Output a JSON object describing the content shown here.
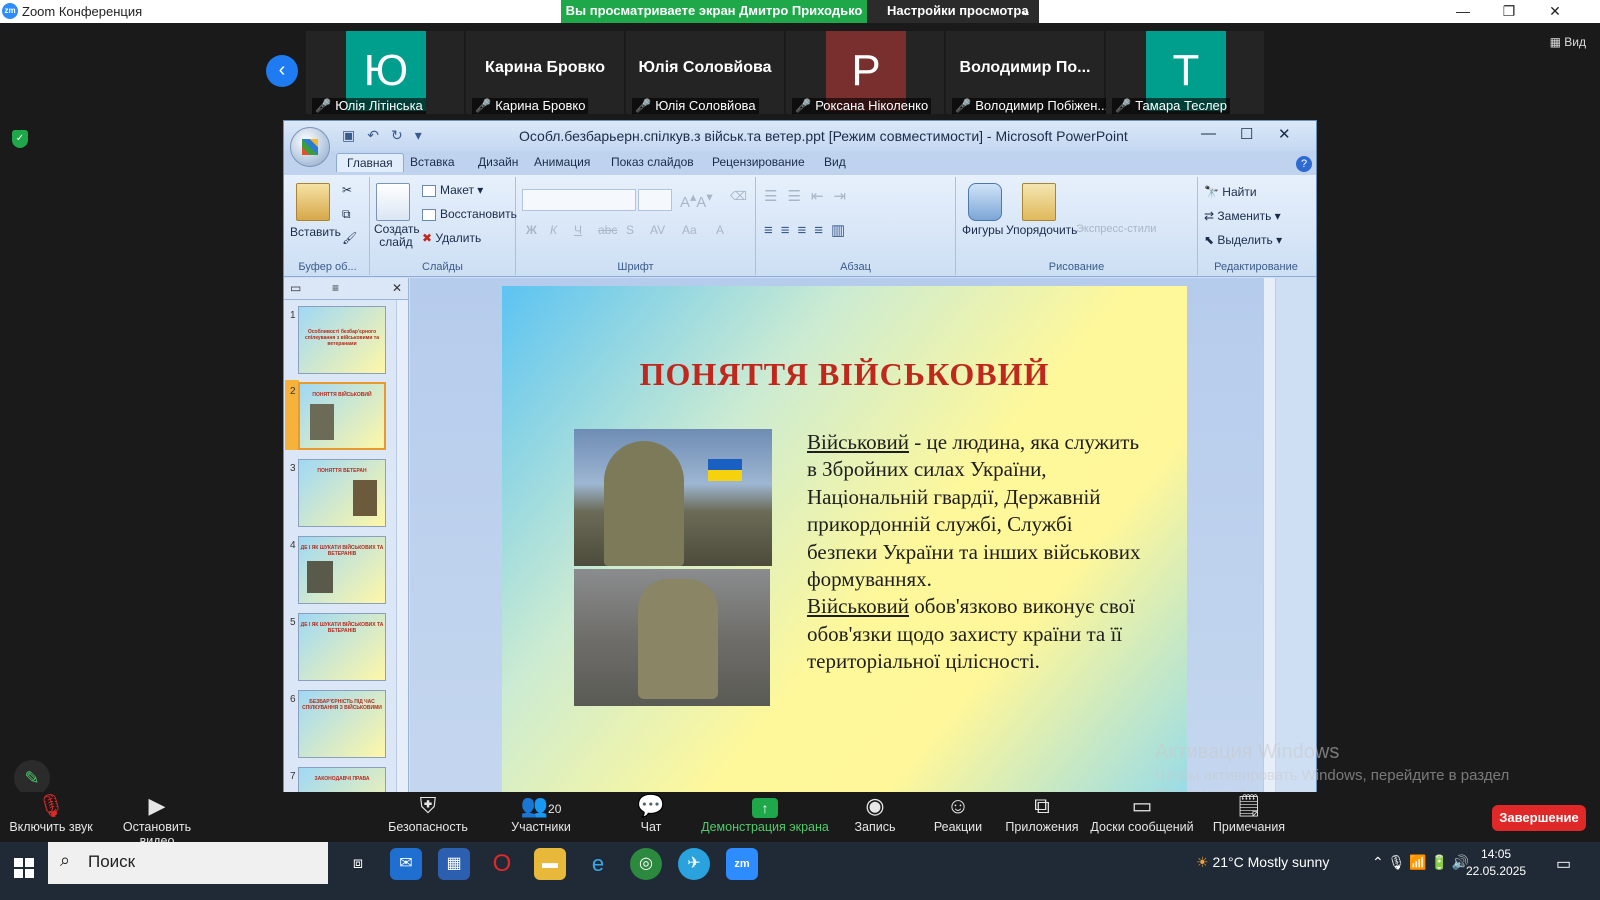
{
  "window": {
    "title": "Zoom Конференция",
    "minimize": "—",
    "restore": "❐",
    "close": "✕"
  },
  "banner": {
    "viewing": "Вы просматриваете экран Дмитро Приходько",
    "settings": "Настройки просмотра",
    "chevron": "⌄"
  },
  "view_button": "Вид",
  "gallery": {
    "back_icon": "‹",
    "tiles": [
      {
        "avatar": "Ю",
        "avatar_color": "#009e8c",
        "name_big": "",
        "label": "Юлія Літінська"
      },
      {
        "avatar": "",
        "avatar_color": "",
        "name_big": "Карина Бровко",
        "label": "Карина Бровко"
      },
      {
        "avatar": "",
        "avatar_color": "",
        "name_big": "Юлія Соловйова",
        "label": "Юлія Соловйова"
      },
      {
        "avatar": "Р",
        "avatar_color": "#7a2f2f",
        "name_big": "",
        "label": "Роксана Ніколенко"
      },
      {
        "avatar": "",
        "avatar_color": "",
        "name_big": "Володимир  По...",
        "label": "Володимир Побіжен..."
      },
      {
        "avatar": "Т",
        "avatar_color": "#009e8c",
        "name_big": "",
        "label": "Тамара Теслер"
      }
    ]
  },
  "ppt": {
    "title": "Особл.безбарьерн.спілкув.з військ.та ветер.ppt [Режим совместимости] - Microsoft PowerPoint",
    "tabs": [
      "Главная",
      "Вставка",
      "Дизайн",
      "Анимация",
      "Показ слайдов",
      "Рецензирование",
      "Вид"
    ],
    "groups": {
      "clipboard": {
        "label": "Буфер об...",
        "paste": "Вставить"
      },
      "slides": {
        "label": "Слайды",
        "new_slide": "Создать слайд",
        "layout": "Макет",
        "reset": "Восстановить",
        "delete": "Удалить"
      },
      "font": {
        "label": "Шрифт",
        "bold": "Ж",
        "italic": "К",
        "underline": "Ч",
        "strike": "abc",
        "shadow": "S",
        "spacing": "AV",
        "case": "Aa",
        "color": "A"
      },
      "paragraph": {
        "label": "Абзац"
      },
      "drawing": {
        "label": "Рисование",
        "shapes": "Фигуры",
        "arrange": "Упорядочить",
        "styles": "Экспресс-стили"
      },
      "editing": {
        "label": "Редактирование",
        "find": "Найти",
        "replace": "Заменить",
        "select": "Выделить"
      }
    },
    "thumbs": [
      {
        "n": "1",
        "title": "Особливості безбар'єрного спілкування з військовими та ветеранами"
      },
      {
        "n": "2",
        "title": "ПОНЯТТЯ ВІЙСЬКОВИЙ"
      },
      {
        "n": "3",
        "title": "ПОНЯТТЯ ВЕТЕРАН"
      },
      {
        "n": "4",
        "title": "ДЕ І ЯК ШУКАТИ ВІЙСЬКОВИХ ТА ВЕТЕРАНІВ"
      },
      {
        "n": "5",
        "title": "ДЕ І ЯК ШУКАТИ ВІЙСЬКОВИХ ТА ВЕТЕРАНІВ"
      },
      {
        "n": "6",
        "title": "БЕЗБАР'ЄРНІСТЬ ПІД ЧАС СПІЛКУВАННЯ З ВІЙСЬКОВИМИ"
      },
      {
        "n": "7",
        "title": "ЗАКОНОДАВЧІ ПРАВА"
      }
    ],
    "slide": {
      "title": "ПОНЯТТЯ ВІЙСЬКОВИЙ",
      "term1": "Військовий",
      "text1": " - це людина, яка служить в Збройних силах України, Національній гвардії, Державній прикордонній службі, Службі безпеки України та інших військових формуваннях.",
      "term2": "Військовий",
      "text2": " обов'язково виконує свої обов'язки щодо захисту країни та її територіальної цілісності."
    }
  },
  "watermark": {
    "line1": "Активация Windows",
    "line2": "Чтобы активировать Windows, перейдите в раздел \"Параметры\"."
  },
  "toolbar": {
    "unmute": "Включить звук",
    "stop_video": "Остановить видео",
    "security": "Безопасность",
    "participants": "Участники",
    "participants_count": "20",
    "chat": "Чат",
    "share": "Демонстрация экрана",
    "record": "Запись",
    "reactions": "Реакции",
    "apps": "Приложения",
    "boards": "Доски сообщений",
    "notes": "Примечания",
    "end": "Завершение"
  },
  "taskbar": {
    "search_placeholder": "Поиск",
    "weather": "21°C  Mostly sunny",
    "time": "14:05",
    "date": "22.05.2025"
  },
  "colors": {
    "zoom_green": "#1fa84a",
    "zoom_blue": "#1e7bf2",
    "end_red": "#e02828",
    "slide_title_red": "#c0281e"
  }
}
